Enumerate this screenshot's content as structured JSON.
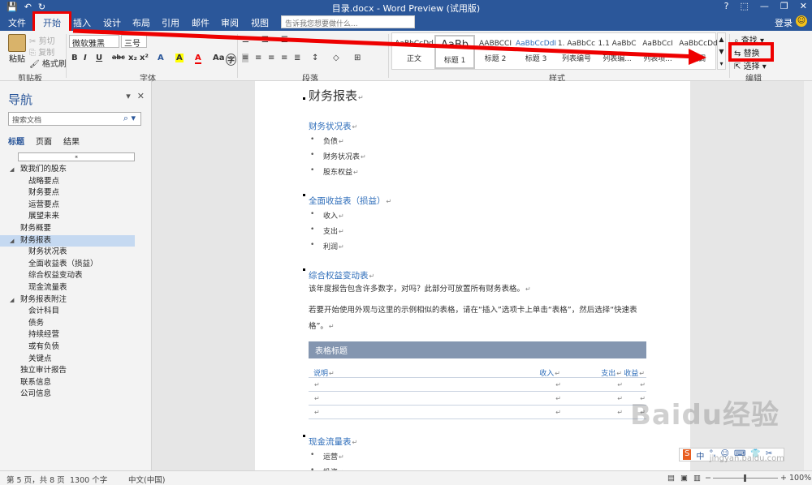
{
  "window": {
    "title": "目录.docx - Word Preview (试用版)",
    "qat": [
      "save-icon",
      "undo-icon",
      "redo-icon"
    ],
    "controls": [
      "?",
      "⬚",
      "—",
      "❐",
      "✕"
    ]
  },
  "menu": {
    "tabs": [
      "文件",
      "开始",
      "插入",
      "设计",
      "布局",
      "引用",
      "邮件",
      "审阅",
      "视图"
    ],
    "active_tab": "开始",
    "tellme_placeholder": "告诉我您想要做什么...",
    "login": "登录",
    "accent": "#2b579a",
    "highlight": "#e00000"
  },
  "ribbon": {
    "clipboard": {
      "paste": "粘贴",
      "cut": "剪切",
      "copy": "复制",
      "painter": "格式刷",
      "label": "剪贴板"
    },
    "font": {
      "family": "微软雅黑",
      "size": "三号",
      "label": "字体",
      "format_buttons": [
        "B",
        "I",
        "U",
        "abc",
        "x₂",
        "x²",
        "A",
        "A",
        "A",
        "Aa",
        "A",
        "字"
      ]
    },
    "paragraph": {
      "label": "段落"
    },
    "styles": {
      "label": "样式",
      "items": [
        {
          "preview": "AaBbCcDd",
          "name": "正文"
        },
        {
          "preview": "AaBb",
          "name": "标题 1"
        },
        {
          "preview": "AABBCCI",
          "name": "标题 2"
        },
        {
          "preview": "AaBbCcDdI",
          "name": "标题 3"
        },
        {
          "preview": "1. AaBbCc",
          "name": "列表编号"
        },
        {
          "preview": "1.1 AaBbC",
          "name": "列表编..."
        },
        {
          "preview": "AaBbCcI",
          "name": "列表项..."
        },
        {
          "preview": "AaBbCcDd",
          "name": "强调"
        }
      ]
    },
    "editing": {
      "find": "查找",
      "replace": "替换",
      "select": "选择",
      "label": "编辑"
    }
  },
  "nav": {
    "title": "导航",
    "search_placeholder": "搜索文档",
    "tabs": [
      "标题",
      "页面",
      "结果"
    ],
    "items": [
      {
        "label": "致我们的股东",
        "level": 0,
        "expand": true
      },
      {
        "label": "战略要点",
        "level": 1
      },
      {
        "label": "财务要点",
        "level": 1
      },
      {
        "label": "运营要点",
        "level": 1
      },
      {
        "label": "展望未来",
        "level": 1
      },
      {
        "label": "财务概要",
        "level": 0
      },
      {
        "label": "财务报表",
        "level": 0,
        "expand": true,
        "selected": true
      },
      {
        "label": "财务状况表",
        "level": 1
      },
      {
        "label": "全面收益表（损益）",
        "level": 1
      },
      {
        "label": "综合权益变动表",
        "level": 1
      },
      {
        "label": "现金流量表",
        "level": 1
      },
      {
        "label": "财务报表附注",
        "level": 0,
        "expand": true
      },
      {
        "label": "会计科目",
        "level": 1
      },
      {
        "label": "债务",
        "level": 1
      },
      {
        "label": "持续经营",
        "level": 1
      },
      {
        "label": "或有负债",
        "level": 1
      },
      {
        "label": "关键点",
        "level": 1
      },
      {
        "label": "独立审计报告",
        "level": 0
      },
      {
        "label": "联系信息",
        "level": 0
      },
      {
        "label": "公司信息",
        "level": 0
      }
    ]
  },
  "document": {
    "h1": "财务报表",
    "sections": [
      {
        "heading": "财务状况表",
        "items": [
          "负债",
          "财务状况表",
          "股东权益"
        ]
      },
      {
        "heading": "全面收益表（损益）",
        "items": [
          "收入",
          "支出",
          "利润"
        ]
      },
      {
        "heading": "综合权益变动表",
        "items": []
      }
    ],
    "para1": "该年度报告包含许多数字，对吗？此部分可放置所有财务表格。",
    "para2": "若要开始使用外观与这里的示例相似的表格，请在“插入”选项卡上单击“表格”，然后选择“快速表格”。",
    "table_title": "表格标题",
    "table_headers": [
      "说明",
      "收入",
      "支出",
      "收益"
    ],
    "cash_heading": "现金流量表",
    "cash_items": [
      "运营",
      "投资"
    ]
  },
  "status": {
    "page": "第 5 页，共 8 页",
    "words": "1300 个字",
    "lang": "中文(中国)",
    "zoom": "100%"
  },
  "watermark": {
    "text": "Baidu经验",
    "url": "jingyan.baidu.com"
  },
  "ime": {
    "items": [
      "S",
      "中",
      "°,",
      "☺",
      "⌨",
      "👕",
      "✂"
    ]
  }
}
